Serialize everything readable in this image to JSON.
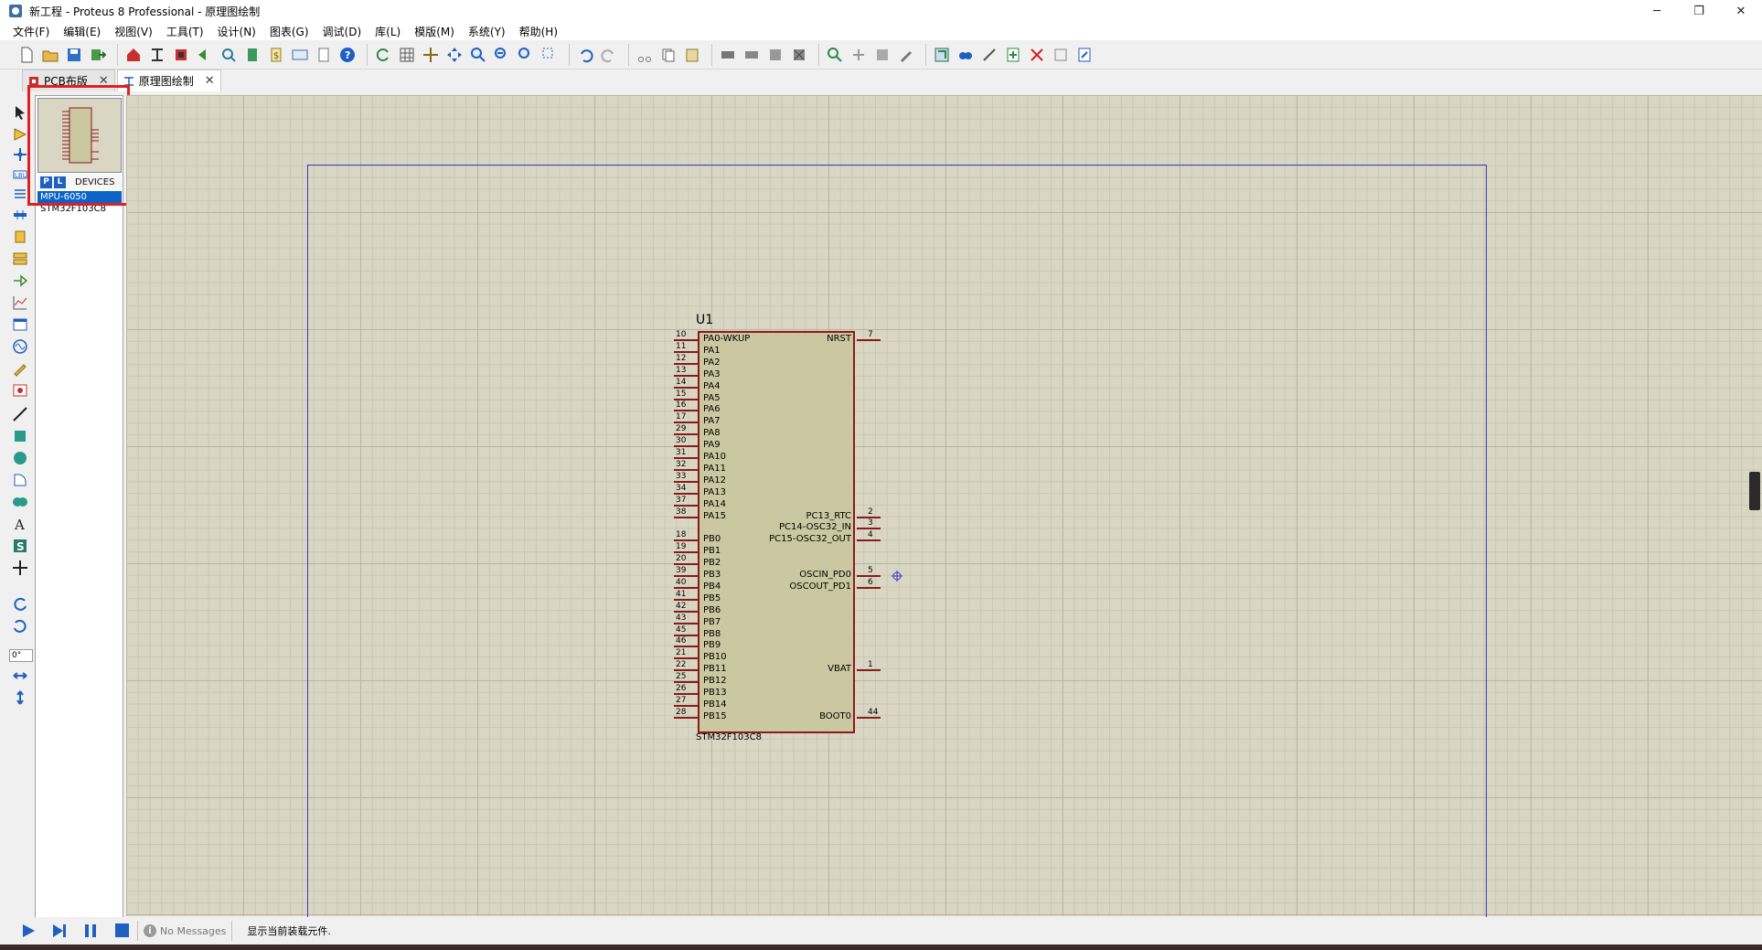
{
  "window": {
    "title": "新工程 - Proteus 8 Professional - 原理图绘制",
    "controls": [
      "─",
      "❐",
      "✕"
    ]
  },
  "menu": [
    "文件(F)",
    "编辑(E)",
    "视图(V)",
    "工具(T)",
    "设计(N)",
    "图表(G)",
    "调试(D)",
    "库(L)",
    "模版(M)",
    "系统(Y)",
    "帮助(H)"
  ],
  "tabs": [
    {
      "label": "PCB布版",
      "close": "✕",
      "icon": "pcb-icon"
    },
    {
      "label": "原理图绘制",
      "close": "✕",
      "icon": "schematic-icon"
    }
  ],
  "selector": {
    "p_button": "P",
    "l_button": "L",
    "title": "DEVICES",
    "items": [
      "MPU-6050",
      "STM32F103C8"
    ],
    "selected": "MPU-6050",
    "angle": "0°"
  },
  "chip": {
    "ref": "U1",
    "value": "STM32F103C8",
    "left_pins": [
      {
        "num": "10",
        "name": "PA0-WKUP"
      },
      {
        "num": "11",
        "name": "PA1"
      },
      {
        "num": "12",
        "name": "PA2"
      },
      {
        "num": "13",
        "name": "PA3"
      },
      {
        "num": "14",
        "name": "PA4"
      },
      {
        "num": "15",
        "name": "PA5"
      },
      {
        "num": "16",
        "name": "PA6"
      },
      {
        "num": "17",
        "name": "PA7"
      },
      {
        "num": "29",
        "name": "PA8"
      },
      {
        "num": "30",
        "name": "PA9"
      },
      {
        "num": "31",
        "name": "PA10"
      },
      {
        "num": "32",
        "name": "PA11"
      },
      {
        "num": "33",
        "name": "PA12"
      },
      {
        "num": "34",
        "name": "PA13"
      },
      {
        "num": "37",
        "name": "PA14"
      },
      {
        "num": "38",
        "name": "PA15"
      },
      {
        "num": "18",
        "name": "PB0"
      },
      {
        "num": "19",
        "name": "PB1"
      },
      {
        "num": "20",
        "name": "PB2"
      },
      {
        "num": "39",
        "name": "PB3"
      },
      {
        "num": "40",
        "name": "PB4"
      },
      {
        "num": "41",
        "name": "PB5"
      },
      {
        "num": "42",
        "name": "PB6"
      },
      {
        "num": "43",
        "name": "PB7"
      },
      {
        "num": "45",
        "name": "PB8"
      },
      {
        "num": "46",
        "name": "PB9"
      },
      {
        "num": "21",
        "name": "PB10"
      },
      {
        "num": "22",
        "name": "PB11"
      },
      {
        "num": "25",
        "name": "PB12"
      },
      {
        "num": "26",
        "name": "PB13"
      },
      {
        "num": "27",
        "name": "PB14"
      },
      {
        "num": "28",
        "name": "PB15"
      }
    ],
    "right_pins": [
      {
        "num": "7",
        "name": "NRST"
      },
      {
        "num": "2",
        "name": "PC13_RTC"
      },
      {
        "num": "3",
        "name": "PC14-OSC32_IN"
      },
      {
        "num": "4",
        "name": "PC15-OSC32_OUT"
      },
      {
        "num": "5",
        "name": "OSCIN_PD0"
      },
      {
        "num": "6",
        "name": "OSCOUT_PD1"
      },
      {
        "num": "1",
        "name": "VBAT"
      },
      {
        "num": "44",
        "name": "BOOT0"
      }
    ]
  },
  "status": {
    "messages": "No Messages",
    "text": "显示当前装载元件."
  },
  "colors": {
    "sheet_bg": "#d9d7c3",
    "chip_fill": "#cbc7a0",
    "pin_color": "#8b1a1a",
    "sheet_border": "#3838c8",
    "highlight": "#e02020",
    "selection": "#0a64c8"
  }
}
